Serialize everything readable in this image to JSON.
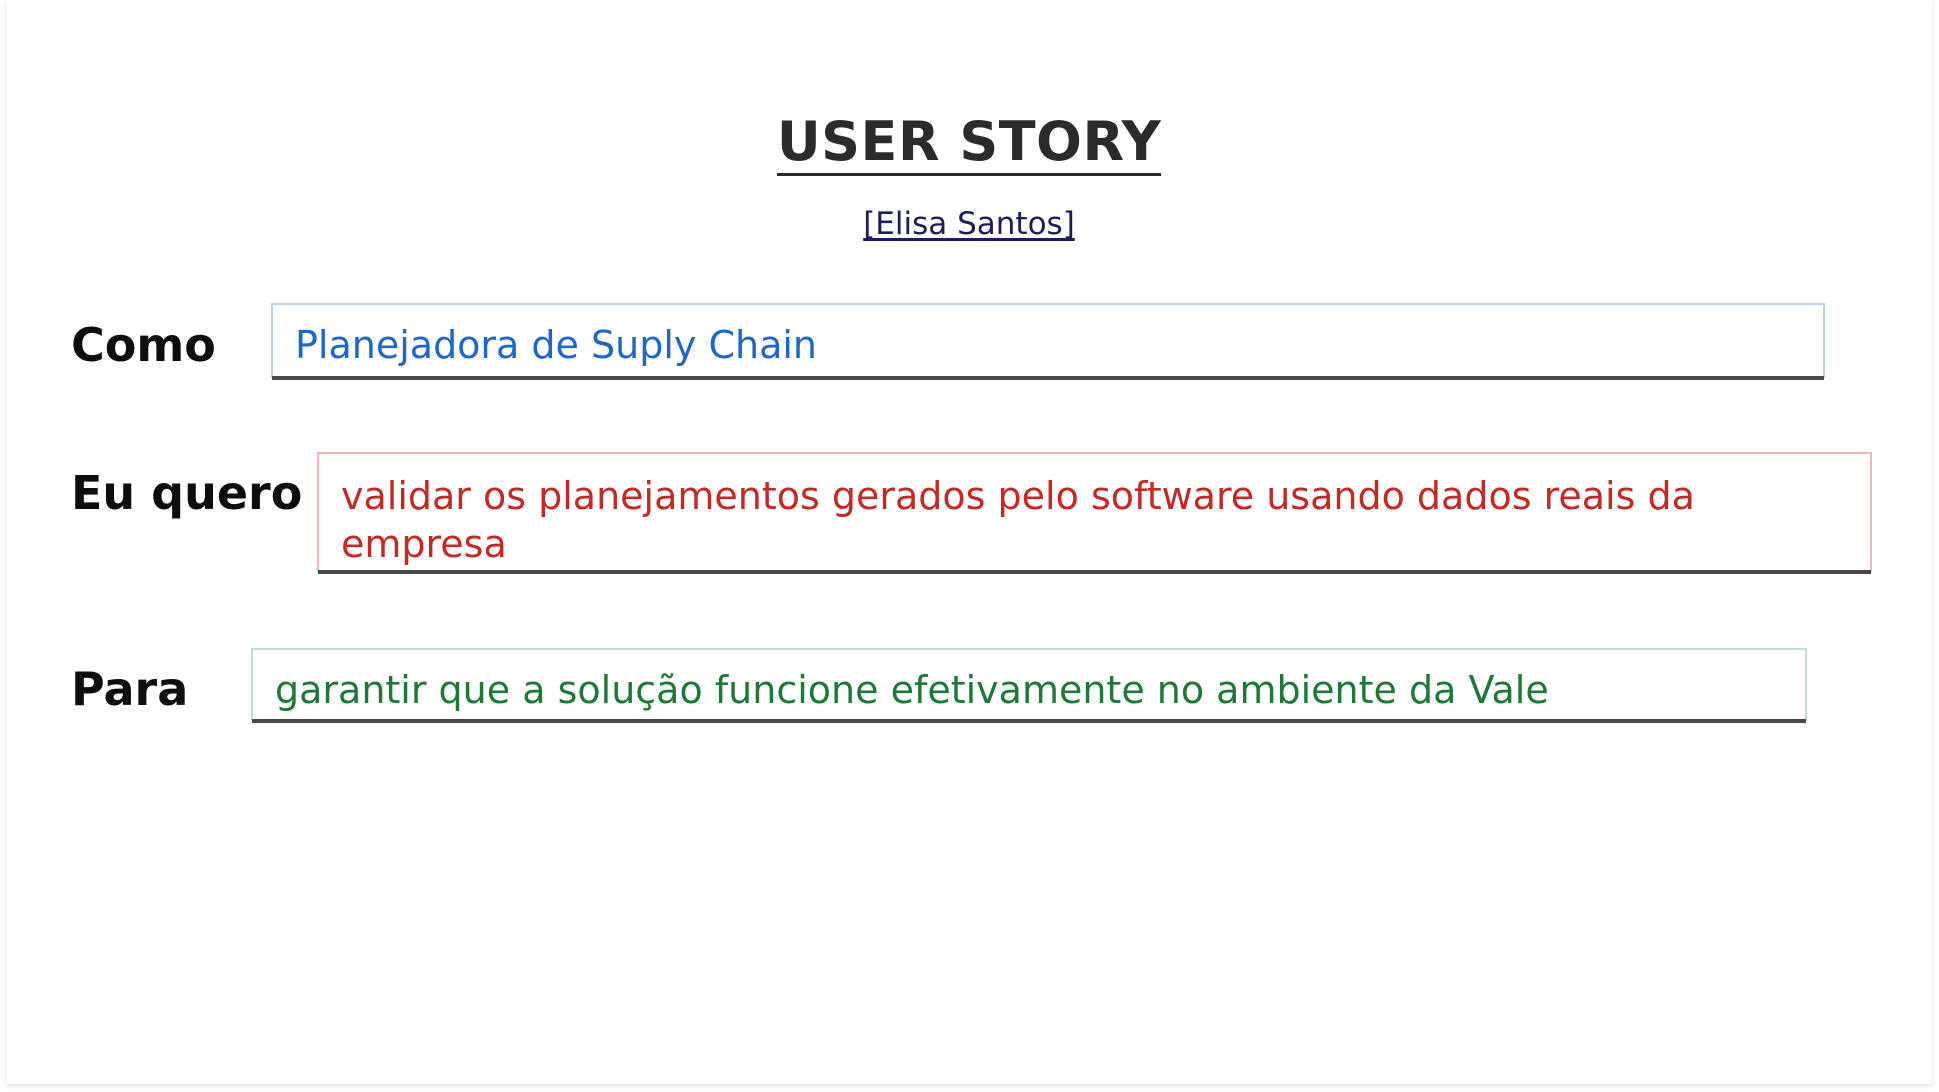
{
  "header": {
    "title": "USER STORY",
    "author": "[Elisa Santos]"
  },
  "story": {
    "como": {
      "label": "Como",
      "value": "Planejadora de Suply Chain",
      "color": "#1e66c8"
    },
    "eu_quero": {
      "label": "Eu quero",
      "value": "validar os planejamentos gerados pelo software usando dados reais da empresa",
      "color": "#c42a23"
    },
    "para": {
      "label": "Para",
      "value": "garantir que a solução funcione efetivamente no ambiente da Vale",
      "color": "#1d7a36"
    }
  }
}
